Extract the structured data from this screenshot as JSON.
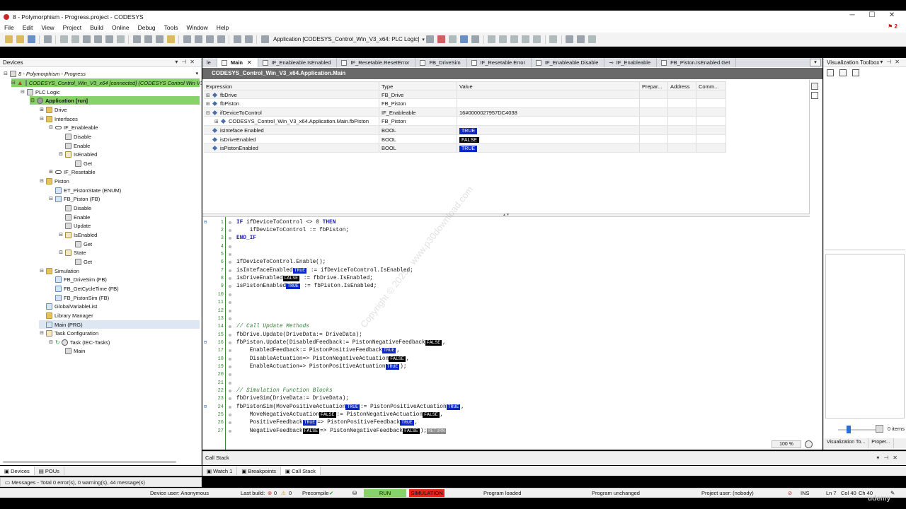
{
  "window": {
    "title": "8 - Polymorphism - Progress.project - CODESYS",
    "controls": [
      "─",
      "☐",
      "✕"
    ]
  },
  "menu": {
    "items": [
      "File",
      "Edit",
      "View",
      "Project",
      "Build",
      "Online",
      "Debug",
      "Tools",
      "Window",
      "Help"
    ],
    "alert_count": "2"
  },
  "toolbar": {
    "application_selector": "Application [CODESYS_Control_Win_V3_x64: PLC Logic]"
  },
  "devices_panel": {
    "title": "Devices",
    "tree": [
      {
        "label": "8 - Polymorphism - Progress",
        "style": "italic"
      },
      {
        "label": "CODESYS_Control_Win_V3_x64 [connected] (CODESYS Control Win V3",
        "style": "green italic"
      },
      {
        "label": "PLC Logic"
      },
      {
        "label": "Application [run]",
        "style": "green bold"
      },
      {
        "label": "Drive"
      },
      {
        "label": "Interfaces"
      },
      {
        "label": "IF_Enableable"
      },
      {
        "label": "Disable"
      },
      {
        "label": "Enable"
      },
      {
        "label": "IsEnabled"
      },
      {
        "label": "Get"
      },
      {
        "label": "IF_Resetable"
      },
      {
        "label": "Piston"
      },
      {
        "label": "ET_PistonState (ENUM)"
      },
      {
        "label": "FB_Piston (FB)"
      },
      {
        "label": "Disable"
      },
      {
        "label": "Enable"
      },
      {
        "label": "Update"
      },
      {
        "label": "IsEnabled"
      },
      {
        "label": "Get"
      },
      {
        "label": "State"
      },
      {
        "label": "Get"
      },
      {
        "label": "Simulation"
      },
      {
        "label": "FB_DriveSim (FB)"
      },
      {
        "label": "FB_GetCycleTime (FB)"
      },
      {
        "label": "FB_PistonSim (FB)"
      },
      {
        "label": "GlobalVariableList"
      },
      {
        "label": "Library Manager"
      },
      {
        "label": "Main (PRG)",
        "style": "selected"
      },
      {
        "label": "Task Configuration"
      },
      {
        "label": "Task (IEC-Tasks)"
      },
      {
        "label": "Main"
      }
    ],
    "bottom_tabs": [
      "Devices",
      "POUs"
    ],
    "messages": "Messages - Total 0 error(s), 0 warning(s), 44 message(s)"
  },
  "editor": {
    "tabs": [
      "le",
      "Main",
      "IF_Enableable.IsEnabled",
      "IF_Resetable.ResetError",
      "FB_DriveSim",
      "IF_Resetable.Error",
      "IF_Enableable.Disable",
      "IF_Enableable",
      "FB_Piston.IsEnabled.Get"
    ],
    "title": "CODESYS_Control_Win_V3_x64.Application.Main",
    "watch_headers": [
      "Expression",
      "Type",
      "Value",
      "Prepar...",
      "Address",
      "Comm..."
    ],
    "watch_rows": [
      {
        "exp": "⊞",
        "name": "fbDrive",
        "type": "FB_Drive",
        "value": "",
        "badge": ""
      },
      {
        "exp": "⊞",
        "name": "fbPiston",
        "type": "FB_Piston",
        "value": "",
        "badge": ""
      },
      {
        "exp": "⊟",
        "name": "ifDeviceToControl",
        "type": "IF_Enableable",
        "value": "16#0000027957DC4038",
        "badge": ""
      },
      {
        "exp": "⊞",
        "name": "CODESYS_Control_Win_V3_x64.Application.Main.fbPiston",
        "type": "FB_Piston",
        "value": "",
        "badge": ""
      },
      {
        "exp": "",
        "name": "isInteface Enabled",
        "type": "BOOL",
        "value": "",
        "badge": "TRUE"
      },
      {
        "exp": "",
        "name": "isDriveEnabled",
        "type": "BOOL",
        "value": "",
        "badge": "FALSE"
      },
      {
        "exp": "",
        "name": "isPistonEnabled",
        "type": "BOOL",
        "value": "",
        "badge": "TRUE"
      }
    ],
    "code_lines": [
      {
        "n": "1",
        "fold": "⊟",
        "segs": [
          [
            "kw",
            "IF"
          ],
          [
            "",
            " ifDeviceToControl <> 0 "
          ],
          [
            "kw",
            "THEN"
          ]
        ]
      },
      {
        "n": "2",
        "fold": "",
        "segs": [
          [
            "",
            "    ifDeviceToControl := fbPiston;"
          ]
        ]
      },
      {
        "n": "3",
        "fold": "",
        "segs": [
          [
            "kw",
            "END_IF"
          ]
        ]
      },
      {
        "n": "4",
        "fold": "",
        "segs": []
      },
      {
        "n": "5",
        "fold": "",
        "segs": []
      },
      {
        "n": "6",
        "fold": "",
        "segs": [
          [
            "",
            "ifDeviceToControl.Enable();"
          ]
        ]
      },
      {
        "n": "7",
        "fold": "",
        "segs": [
          [
            "",
            "isIntefaceEnabled"
          ],
          [
            "t",
            "TRUE"
          ],
          [
            "",
            " := ifDeviceToControl.IsEnabled;"
          ]
        ]
      },
      {
        "n": "8",
        "fold": "",
        "segs": [
          [
            "",
            "isDriveEnabled"
          ],
          [
            "f",
            "FALSE"
          ],
          [
            "",
            " := fbDrive.IsEnabled;"
          ]
        ]
      },
      {
        "n": "9",
        "fold": "",
        "segs": [
          [
            "",
            "isPistonEnabled"
          ],
          [
            "t",
            "TRUE"
          ],
          [
            "",
            " := fbPiston.IsEnabled;"
          ]
        ]
      },
      {
        "n": "10",
        "fold": "",
        "segs": []
      },
      {
        "n": "11",
        "fold": "",
        "segs": []
      },
      {
        "n": "12",
        "fold": "",
        "segs": []
      },
      {
        "n": "13",
        "fold": "",
        "segs": []
      },
      {
        "n": "14",
        "fold": "",
        "segs": [
          [
            "cm",
            "// Call Update Methods"
          ]
        ]
      },
      {
        "n": "15",
        "fold": "",
        "segs": [
          [
            "",
            "fbDrive.Update(DriveData:= DriveData);"
          ]
        ]
      },
      {
        "n": "16",
        "fold": "⊟",
        "segs": [
          [
            "",
            "fbPiston.Update(DisabledFeedback:= PistonNegativeFeedback"
          ],
          [
            "f",
            "FALSE"
          ],
          [
            "",
            ","
          ]
        ]
      },
      {
        "n": "17",
        "fold": "",
        "segs": [
          [
            "",
            "    EnabledFeedback:= PistonPositiveFeedback"
          ],
          [
            "t",
            "TRUE"
          ],
          [
            "",
            ","
          ]
        ]
      },
      {
        "n": "18",
        "fold": "",
        "segs": [
          [
            "",
            "    DisableActuation=> PistonNegativeActuation"
          ],
          [
            "f",
            "FALSE"
          ],
          [
            "",
            ","
          ]
        ]
      },
      {
        "n": "19",
        "fold": "",
        "segs": [
          [
            "",
            "    EnableActuation=> PistonPositiveActuation"
          ],
          [
            "t",
            "TRUE"
          ],
          [
            "",
            ");"
          ]
        ]
      },
      {
        "n": "20",
        "fold": "",
        "segs": []
      },
      {
        "n": "21",
        "fold": "",
        "segs": []
      },
      {
        "n": "22",
        "fold": "",
        "segs": [
          [
            "cm",
            "// Simulation Function Blocks"
          ]
        ]
      },
      {
        "n": "23",
        "fold": "",
        "segs": [
          [
            "",
            "fbDriveSim(DriveData:= DriveData);"
          ]
        ]
      },
      {
        "n": "24",
        "fold": "⊟",
        "segs": [
          [
            "",
            "fbPistonSim(MovePositiveActuation"
          ],
          [
            "t",
            "TRUE"
          ],
          [
            "",
            ":= PistonPositiveActuation"
          ],
          [
            "t",
            "TRUE"
          ],
          [
            "",
            ","
          ]
        ]
      },
      {
        "n": "25",
        "fold": "",
        "segs": [
          [
            "",
            "    MoveNegativeActuation"
          ],
          [
            "f",
            "FALSE"
          ],
          [
            "",
            ":= PistonNegativeActuation"
          ],
          [
            "f",
            "FALSE"
          ],
          [
            "",
            ","
          ]
        ]
      },
      {
        "n": "26",
        "fold": "",
        "segs": [
          [
            "",
            "    PositiveFeedback"
          ],
          [
            "t",
            "TRUE"
          ],
          [
            "",
            "=> PistonPositiveFeedback"
          ],
          [
            "t",
            "TRUE"
          ],
          [
            "",
            ","
          ]
        ]
      },
      {
        "n": "27",
        "fold": "",
        "segs": [
          [
            "",
            "    NegativeFeedback"
          ],
          [
            "f",
            "FALSE"
          ],
          [
            "",
            "=> PistonNegativeFeedback"
          ],
          [
            "f",
            "FALSE"
          ],
          [
            "",
            ");"
          ],
          [
            "r",
            "RETURN"
          ]
        ]
      }
    ],
    "zoom": "100 %",
    "watermark": "Copyright © 2025 - www.p30download.com"
  },
  "callstack": {
    "title": "Call Stack",
    "tabs": [
      "Watch 1",
      "Breakpoints",
      "Call Stack"
    ]
  },
  "vistoolbox": {
    "title": "Visualization Toolbox",
    "items": "0 items",
    "tabs": [
      "Visualization To...",
      "Proper..."
    ]
  },
  "statusbar": {
    "device_user": "Device user: Anonymous",
    "last_build": "Last build:",
    "errors": "0",
    "warnings": "0",
    "precompile": "Precompile",
    "run": "RUN",
    "simulation": "SIMULATION",
    "program_loaded": "Program loaded",
    "program_unchanged": "Program unchanged",
    "project_user": "Project user: (nobody)",
    "ins": "INS",
    "ln": "Ln 7",
    "col": "Col 40",
    "ch": "Ch 40"
  },
  "colors": {
    "run": "#87d36a",
    "simulation": "#e2281f",
    "true_badge": "#0a28c9",
    "false_badge": "#000000"
  },
  "overlay": {
    "udemy": "udemy"
  }
}
